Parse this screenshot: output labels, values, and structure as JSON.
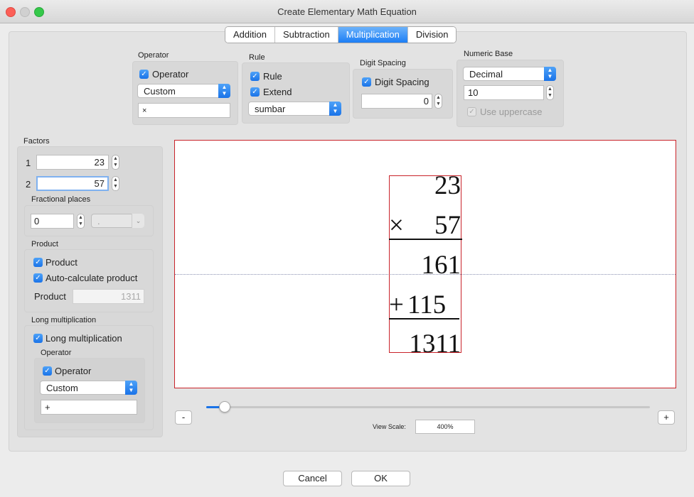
{
  "window": {
    "title": "Create Elementary Math Equation"
  },
  "tabs": [
    {
      "label": "Addition",
      "active": false
    },
    {
      "label": "Subtraction",
      "active": false
    },
    {
      "label": "Multiplication",
      "active": true
    },
    {
      "label": "Division",
      "active": false
    }
  ],
  "operator": {
    "group_label": "Operator",
    "checkbox_label": "Operator",
    "checked": true,
    "select_value": "Custom",
    "text_value": "×"
  },
  "rule": {
    "group_label": "Rule",
    "rule_label": "Rule",
    "extend_label": "Extend",
    "select_value": "sumbar"
  },
  "digit_spacing": {
    "group_label": "Digit Spacing",
    "checkbox_label": "Digit Spacing",
    "value": "0"
  },
  "numeric_base": {
    "group_label": "Numeric Base",
    "select_value": "Decimal",
    "base_value": "10",
    "uppercase_label": "Use uppercase"
  },
  "factors": {
    "group_label": "Factors",
    "items": [
      {
        "index": "1",
        "value": "23"
      },
      {
        "index": "2",
        "value": "57"
      }
    ],
    "fractional_label": "Fractional places",
    "fractional_value": "0",
    "separator_value": "."
  },
  "product": {
    "group_label": "Product",
    "checkbox_label": "Product",
    "auto_label": "Auto-calculate product",
    "field_label": "Product",
    "field_value": "1311"
  },
  "long_mult": {
    "group_label": "Long multiplication",
    "checkbox_label": "Long multiplication",
    "operator_group_label": "Operator",
    "operator_checkbox_label": "Operator",
    "select_value": "Custom",
    "text_value": "+"
  },
  "equation": {
    "factor1": "23",
    "operator": "×",
    "factor2": "57",
    "partial1": "161",
    "plus": "+",
    "partial2": "115",
    "result": "1311"
  },
  "view": {
    "minus_label": "-",
    "plus_label": "+",
    "scale_label": "View Scale:",
    "scale_value": "400%",
    "slider_fraction": 0.03
  },
  "buttons": {
    "cancel": "Cancel",
    "ok": "OK"
  },
  "colors": {
    "accent": "#1a73e8",
    "canvas_border": "#c9232a"
  }
}
